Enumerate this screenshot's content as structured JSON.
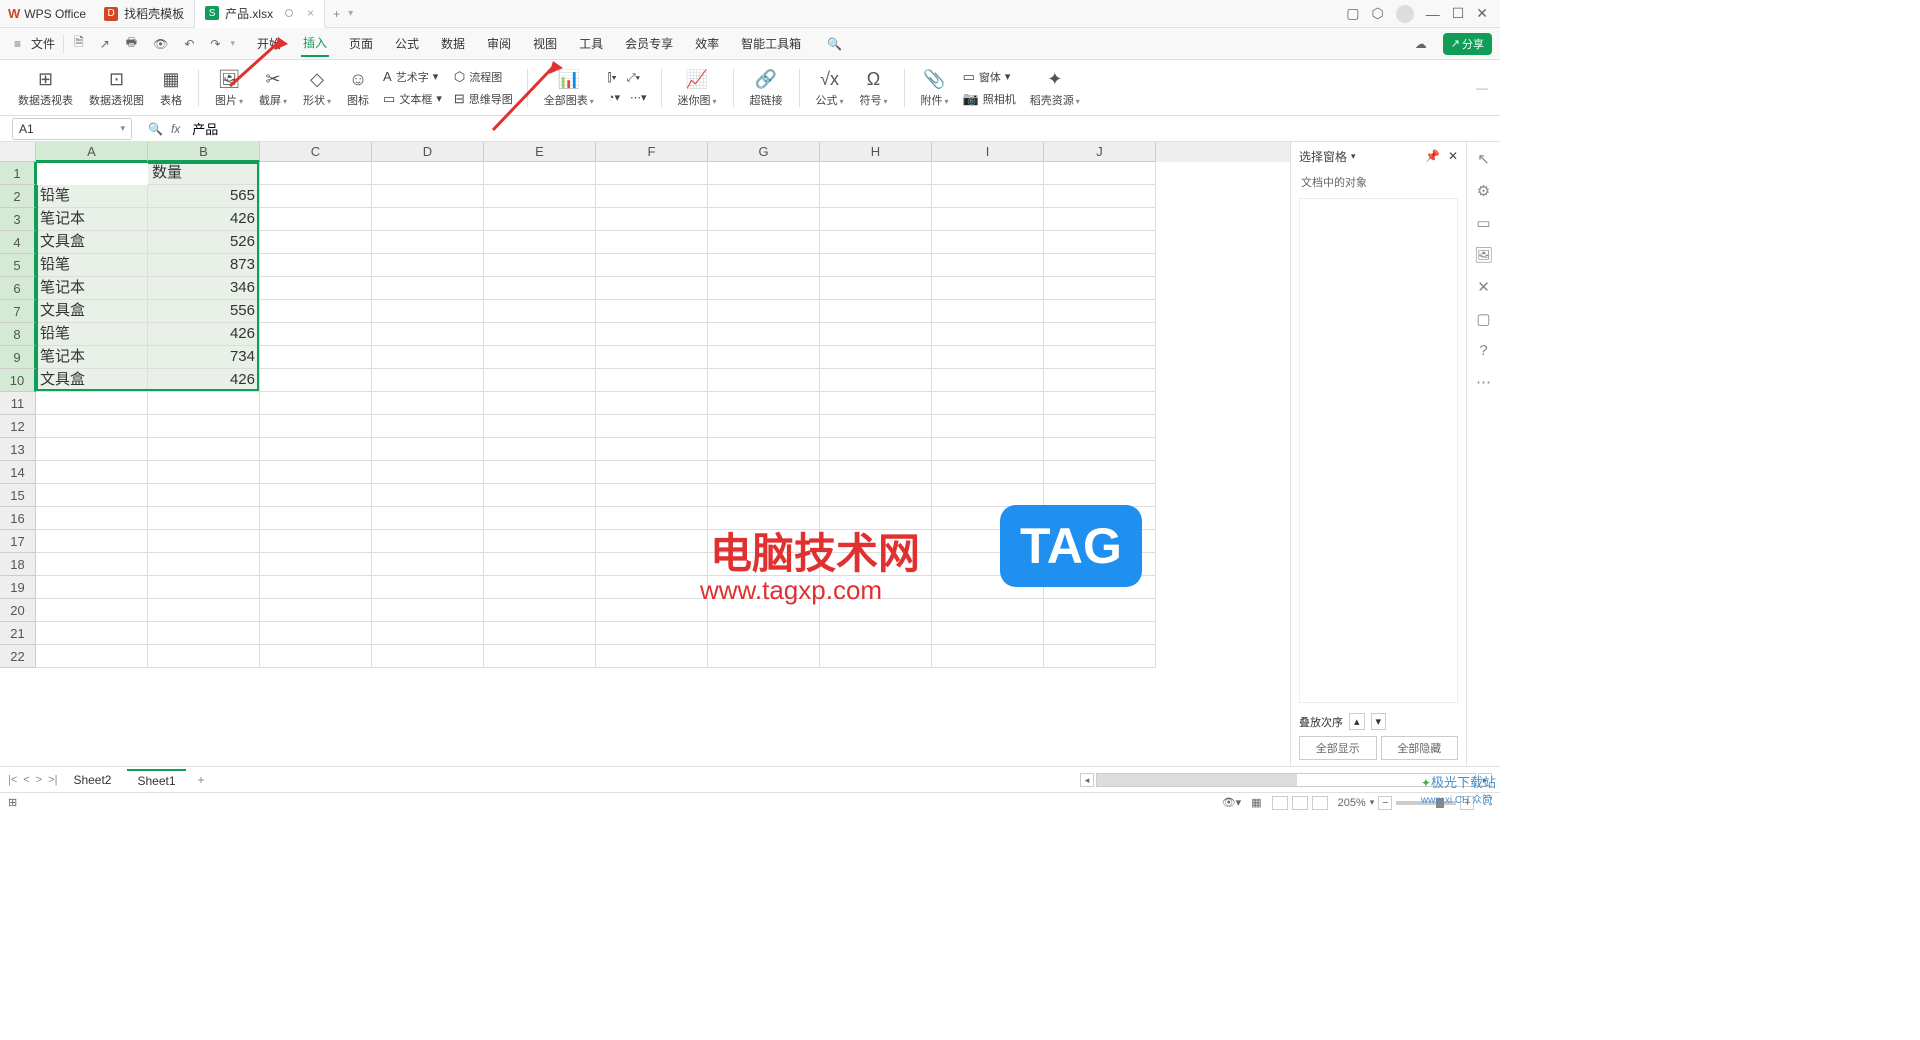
{
  "app_name": "WPS Office",
  "tabs": [
    {
      "label": "找稻壳模板"
    },
    {
      "label": "产品.xlsx",
      "active": true,
      "icon_letter": "S"
    }
  ],
  "menu": {
    "file": "文件",
    "items": [
      "开始",
      "插入",
      "页面",
      "公式",
      "数据",
      "审阅",
      "视图",
      "工具",
      "会员专享",
      "效率",
      "智能工具箱"
    ],
    "active": "插入",
    "share": "分享"
  },
  "ribbon": {
    "groups": [
      [
        {
          "label": "数据透视表",
          "icon": "⊞"
        },
        {
          "label": "数据透视图",
          "icon": "⊡"
        },
        {
          "label": "表格",
          "icon": "▦"
        }
      ],
      [
        {
          "label": "图片",
          "icon": "🖼",
          "dropdown": true
        },
        {
          "label": "截屏",
          "icon": "✂",
          "dropdown": true
        },
        {
          "label": "形状",
          "icon": "◇",
          "dropdown": true
        },
        {
          "label": "图标",
          "icon": "☺"
        }
      ],
      [],
      [
        {
          "label": "全部图表",
          "icon": "📊",
          "dropdown": true
        }
      ],
      [],
      [
        {
          "label": "迷你图",
          "icon": "📈",
          "dropdown": true
        }
      ],
      [
        {
          "label": "超链接",
          "icon": "🔗"
        }
      ],
      [
        {
          "label": "公式",
          "icon": "√x",
          "dropdown": true
        },
        {
          "label": "符号",
          "icon": "Ω",
          "dropdown": true
        }
      ],
      [
        {
          "label": "附件",
          "icon": "📎",
          "dropdown": true
        },
        {
          "label": "照相机",
          "icon": "📷"
        }
      ],
      [
        {
          "label": "稻壳资源",
          "icon": "✦",
          "dropdown": true
        }
      ]
    ],
    "small_rows": {
      "art": "艺术字",
      "text": "文本框",
      "flow": "流程图",
      "mind": "思维导图",
      "object": "窗体"
    },
    "chart_icons": [
      "⫿",
      "⫾",
      "⤢",
      "◔",
      "⋯"
    ],
    "line_chart": "📉"
  },
  "formula_bar": {
    "cell_ref": "A1",
    "value": "产品"
  },
  "columns": [
    "A",
    "B",
    "C",
    "D",
    "E",
    "F",
    "G",
    "H",
    "I",
    "J"
  ],
  "selected_cols": [
    "A",
    "B"
  ],
  "selected_rows": [
    1,
    2,
    3,
    4,
    5,
    6,
    7,
    8,
    9,
    10
  ],
  "data": [
    {
      "c0": "产品",
      "c1": "数量"
    },
    {
      "c0": "铅笔",
      "c1": "565"
    },
    {
      "c0": "笔记本",
      "c1": "426"
    },
    {
      "c0": "文具盒",
      "c1": "526"
    },
    {
      "c0": "铅笔",
      "c1": "873"
    },
    {
      "c0": "笔记本",
      "c1": "346"
    },
    {
      "c0": "文具盒",
      "c1": "556"
    },
    {
      "c0": "铅笔",
      "c1": "426"
    },
    {
      "c0": "笔记本",
      "c1": "734"
    },
    {
      "c0": "文具盒",
      "c1": "426"
    }
  ],
  "right_panel": {
    "title": "选择窗格",
    "subtitle": "文档中的对象",
    "order": "叠放次序",
    "show_all": "全部显示",
    "hide_all": "全部隐藏"
  },
  "sheets": {
    "list": [
      "Sheet2",
      "Sheet1"
    ],
    "active": "Sheet1"
  },
  "status": {
    "zoom": "205%"
  },
  "watermark": {
    "text": "电脑技术网",
    "url": "www.tagxp.com",
    "tag": "TAG",
    "corner1": "极光下载站",
    "corner2": "www.xi CH 众简"
  }
}
